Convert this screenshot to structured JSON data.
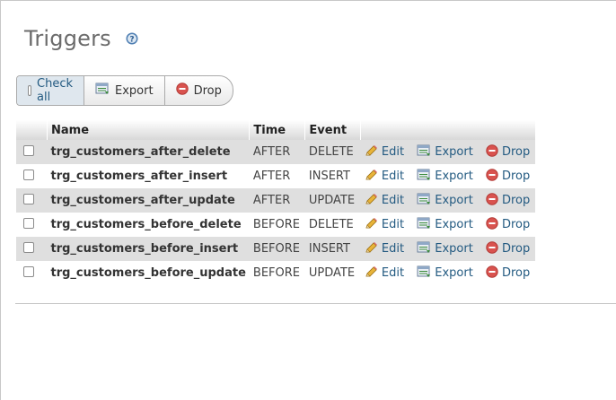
{
  "page": {
    "title": "Triggers"
  },
  "toolbar": {
    "check_all_label": "Check all",
    "export_label": "Export",
    "drop_label": "Drop"
  },
  "table": {
    "headers": {
      "name": "Name",
      "time": "Time",
      "event": "Event"
    },
    "action_labels": {
      "edit": "Edit",
      "export": "Export",
      "drop": "Drop"
    },
    "rows": [
      {
        "name": "trg_customers_after_delete",
        "time": "AFTER",
        "event": "DELETE"
      },
      {
        "name": "trg_customers_after_insert",
        "time": "AFTER",
        "event": "INSERT"
      },
      {
        "name": "trg_customers_after_update",
        "time": "AFTER",
        "event": "UPDATE"
      },
      {
        "name": "trg_customers_before_delete",
        "time": "BEFORE",
        "event": "DELETE"
      },
      {
        "name": "trg_customers_before_insert",
        "time": "BEFORE",
        "event": "INSERT"
      },
      {
        "name": "trg_customers_before_update",
        "time": "BEFORE",
        "event": "UPDATE"
      }
    ]
  },
  "colors": {
    "link": "#235a81",
    "row_alt": "#dfdfdf",
    "drop_red": "#d9534f",
    "edit_pencil": "#e8b43a",
    "export_green": "#3b8b3b"
  }
}
